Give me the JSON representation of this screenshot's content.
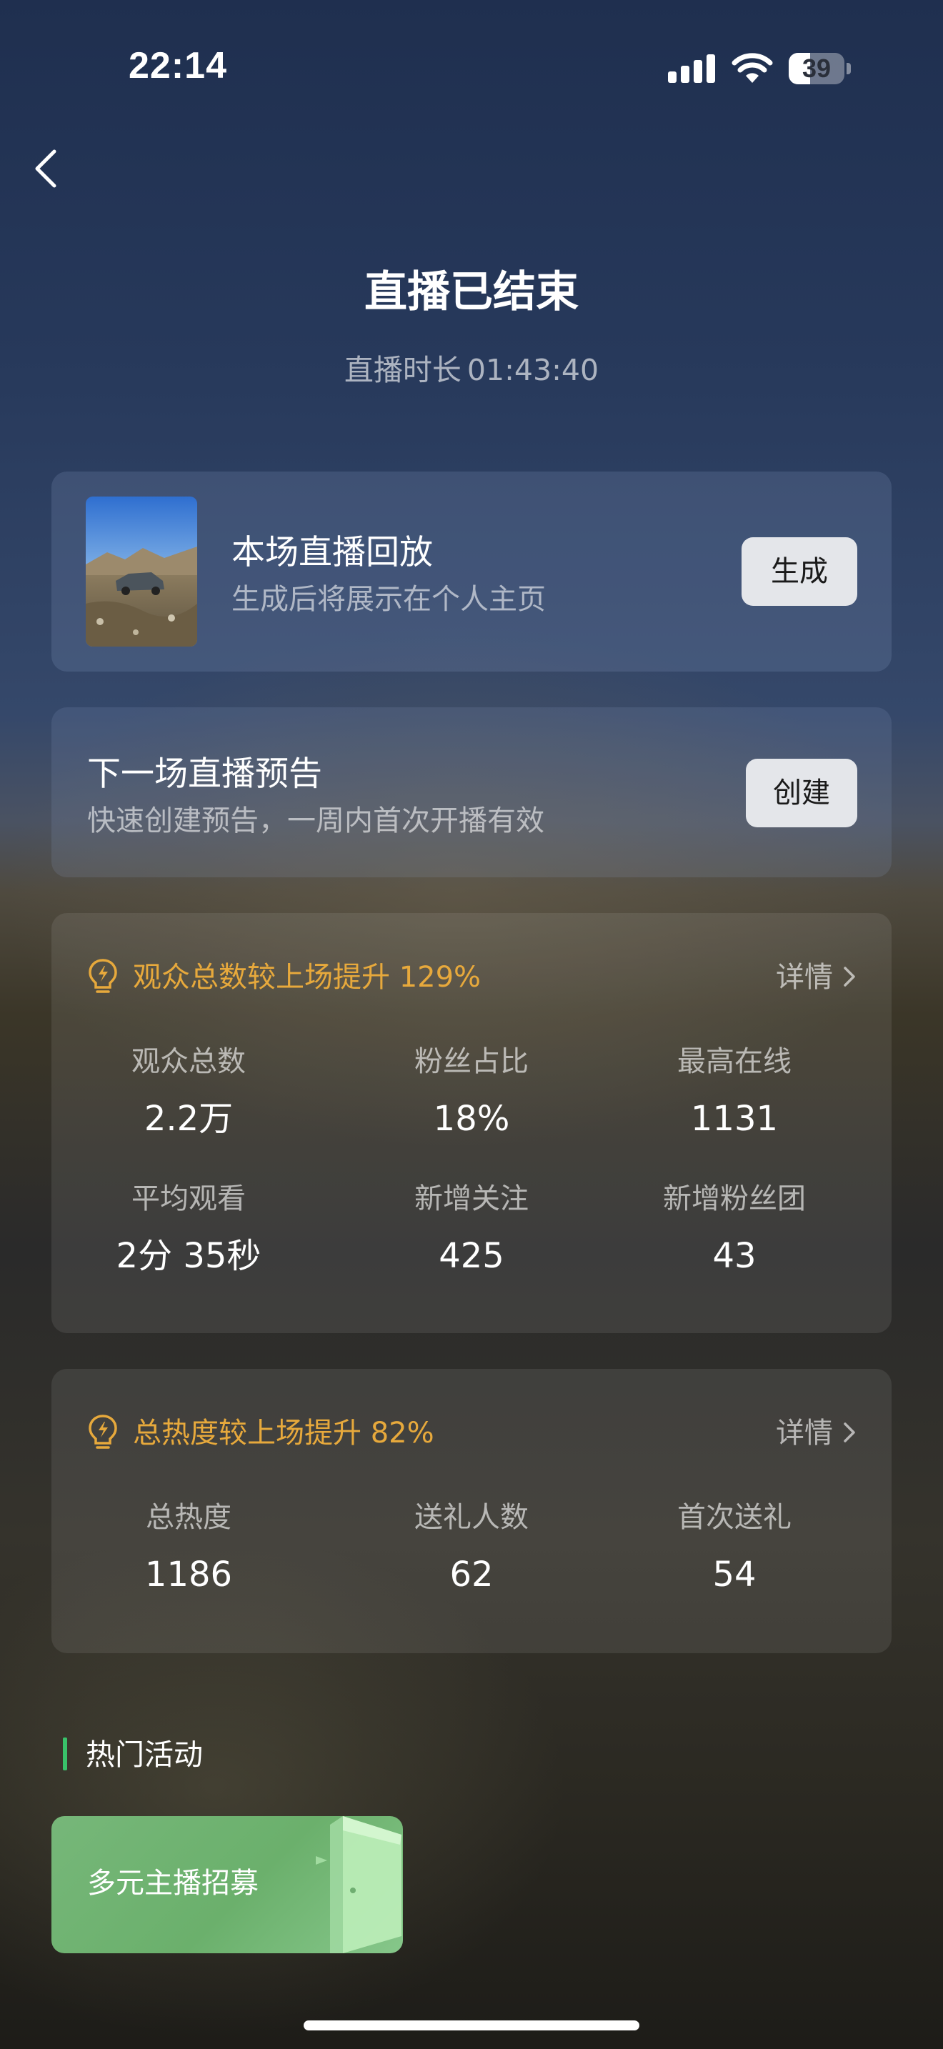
{
  "status_bar": {
    "time": "22:14",
    "battery_level": "39",
    "battery_fraction": 0.39
  },
  "header": {
    "back_icon": "chevron-left-icon",
    "title": "直播已结束",
    "duration_label": "直播时长",
    "duration_value": "01:43:40"
  },
  "replay_card": {
    "title": "本场直播回放",
    "subtitle": "生成后将展示在个人主页",
    "button_label": "生成"
  },
  "preview_card": {
    "title": "下一场直播预告",
    "subtitle": "快速创建预告，一周内首次开播有效",
    "button_label": "创建"
  },
  "audience_card": {
    "insight": "观众总数较上场提升 129%",
    "detail_label": "详情",
    "stats": [
      {
        "label": "观众总数",
        "value": "2.2万"
      },
      {
        "label": "粉丝占比",
        "value": "18%"
      },
      {
        "label": "最高在线",
        "value": "1131"
      },
      {
        "label": "平均观看",
        "value": "2分 35秒"
      },
      {
        "label": "新增关注",
        "value": "425"
      },
      {
        "label": "新增粉丝团",
        "value": "43"
      }
    ]
  },
  "heat_card": {
    "insight": "总热度较上场提升 82%",
    "detail_label": "详情",
    "stats": [
      {
        "label": "总热度",
        "value": "1186"
      },
      {
        "label": "送礼人数",
        "value": "62"
      },
      {
        "label": "首次送礼",
        "value": "54"
      }
    ]
  },
  "activities": {
    "section_title": "热门活动",
    "items": [
      {
        "label": "多元主播招募"
      }
    ]
  },
  "colors": {
    "insight": "#e7a93c",
    "section_accent": "#39c26a",
    "activity_card": "#76b779",
    "button_bg": "#e4e6ea"
  }
}
